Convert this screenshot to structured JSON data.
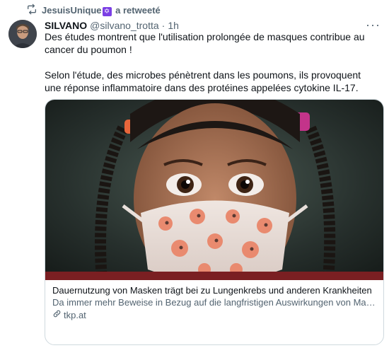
{
  "retweet": {
    "user": "JesuisUnique",
    "badge": "✡",
    "label": "a retweeté"
  },
  "tweet": {
    "author_name": "SILVANO",
    "author_handle": "@silvano_trotta",
    "separator": "·",
    "time": "1h",
    "more": "···",
    "text": "Des études montrent que l'utilisation prolongée de masques contribue au cancer du poumon !\n\nSelon l'étude, des microbes pénètrent dans les poumons, ils provoquent une réponse inflammatoire dans des protéines appelées cytokine IL-17."
  },
  "card": {
    "title": "Dauernutzung von Masken trägt bei zu Lungenkrebs und anderen Krankheiten",
    "description": "Da immer mehr Beweise in Bezug auf die langfristigen Auswirkungen von Maskenpflicht und Lockdowns auftauchen, beginnen Arzte und Wissenschaftl…",
    "domain": "tkp.at"
  },
  "colors": {
    "text": "#0f1419",
    "secondary": "#536471",
    "border": "#cfd9de",
    "badge": "#7b3fe4"
  },
  "icons": [
    "retweet-icon",
    "star-of-david-icon",
    "more-icon",
    "link-icon"
  ]
}
